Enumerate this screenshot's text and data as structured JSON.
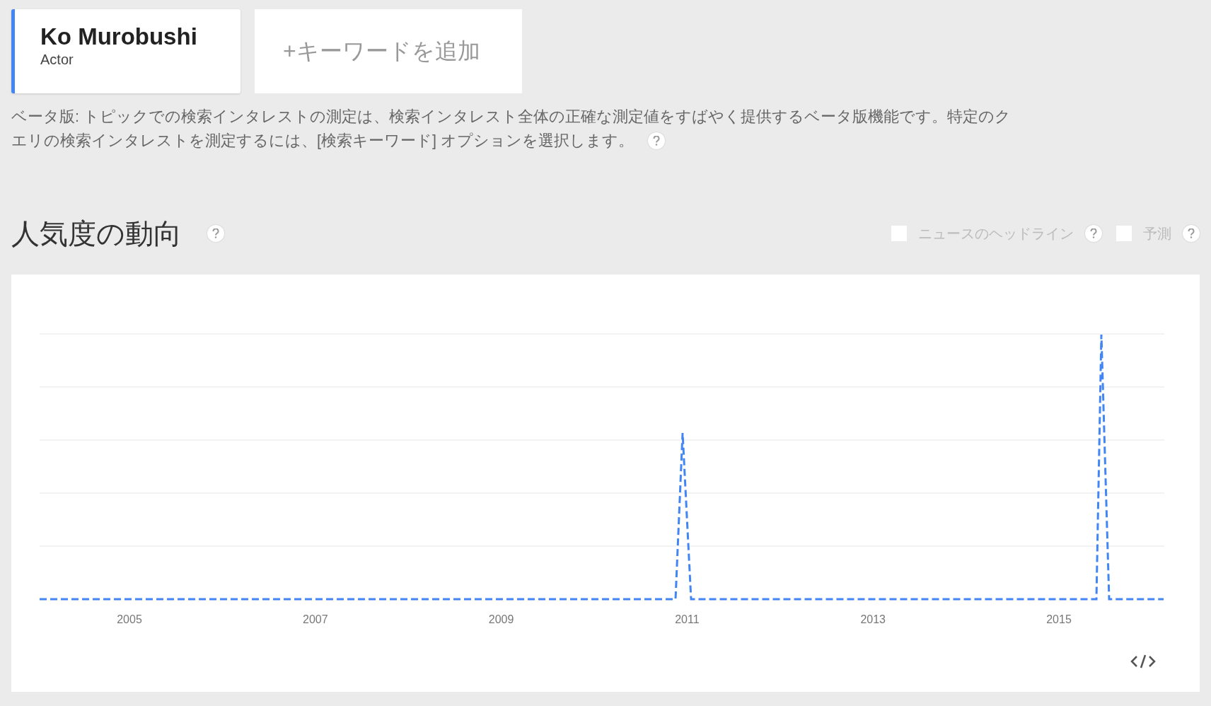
{
  "topic_card": {
    "title": "Ko Murobushi",
    "subtitle": "Actor",
    "color": "#4285f4"
  },
  "add_keyword": {
    "label": "+キーワードを追加"
  },
  "beta_notice_lines": [
    "ベータ版: トピックでの検索インタレストの測定は、検索インタレスト全体の正確な測定値をすばやく提供するベータ版機能です。特定のク",
    "エリの検索インタレストを測定するには、[検索キーワード] オプションを選択します。"
  ],
  "section": {
    "title": "人気度の動向"
  },
  "options": [
    {
      "label": "ニュースのヘッドライン",
      "checked": false
    },
    {
      "label": "予測",
      "checked": false
    }
  ],
  "chart": {
    "x_labels": [
      "2005",
      "2007",
      "2009",
      "2011",
      "2013",
      "2015"
    ]
  }
}
